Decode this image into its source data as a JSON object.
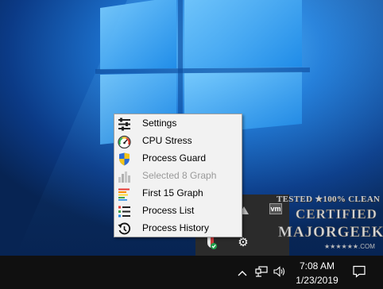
{
  "context_menu": {
    "items": [
      {
        "label": "Settings",
        "icon": "settings-sliders-icon",
        "enabled": true
      },
      {
        "label": "CPU Stress",
        "icon": "gauge-icon",
        "enabled": true
      },
      {
        "label": "Process Guard",
        "icon": "shield-icon",
        "enabled": true
      },
      {
        "label": "Selected 8 Graph",
        "icon": "bar-graph-icon",
        "enabled": false
      },
      {
        "label": "First 15 Graph",
        "icon": "colored-bars-icon",
        "enabled": true
      },
      {
        "label": "Process List",
        "icon": "list-icon",
        "enabled": true
      },
      {
        "label": "Process History",
        "icon": "history-icon",
        "enabled": true
      }
    ]
  },
  "tray_flyout": {
    "icons": [
      "gray-triangle-icon",
      "vm-icon",
      "shield-check-icon",
      "gear-icon"
    ],
    "vm_text": "vm"
  },
  "watermark": {
    "top": "TESTED ★100% CLEAN",
    "line1": "CERTIFIED",
    "line2": "MAJORGEEKS",
    "url": "★★★★★★.COM"
  },
  "taskbar": {
    "time": "7:08 AM",
    "date": "1/23/2019",
    "icons": [
      "chevron-up-icon",
      "network-icon",
      "volume-icon",
      "notification-icon"
    ]
  },
  "colors": {
    "desktop_dark": "#0a2d66",
    "desktop_light": "#3ba2ee",
    "taskbar": "#101010",
    "menu_bg": "#f2f2f2"
  }
}
